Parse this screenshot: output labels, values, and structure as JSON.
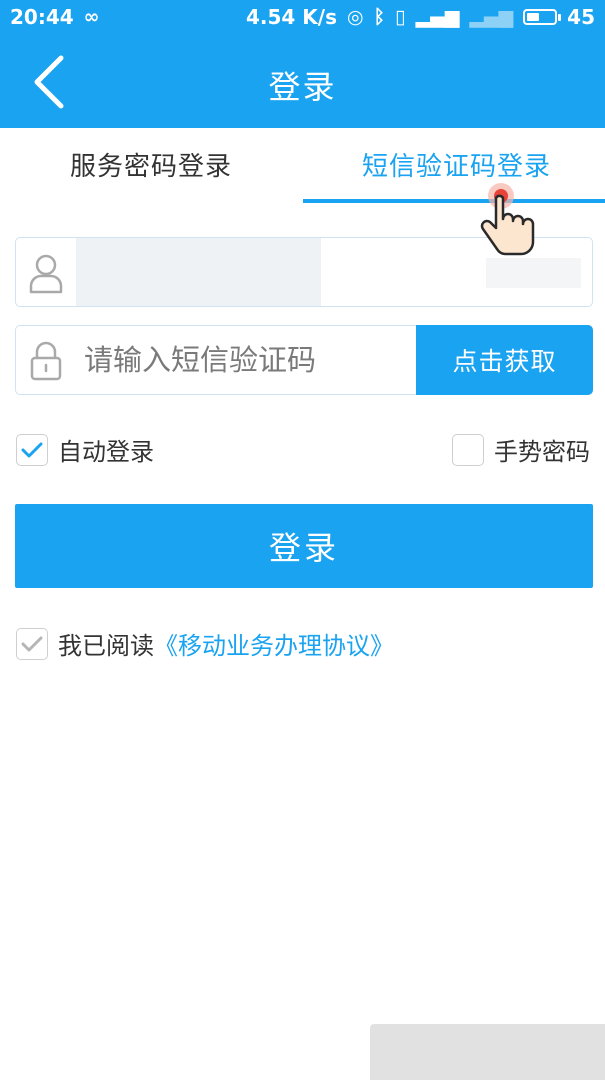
{
  "statusbar": {
    "time": "20:44",
    "speed": "4.54 K/s",
    "battery": "45"
  },
  "header": {
    "title": "登录"
  },
  "tabs": [
    {
      "label": "服务密码登录",
      "active": false
    },
    {
      "label": "短信验证码登录",
      "active": true
    }
  ],
  "form": {
    "code_placeholder": "请输入短信验证码",
    "get_code_label": "点击获取"
  },
  "options": {
    "auto_login_label": "自动登录",
    "auto_login_checked": true,
    "gesture_label": "手势密码",
    "gesture_checked": false
  },
  "login_button": "登录",
  "agreement": {
    "prefix": "我已阅读",
    "link": "《移动业务办理协议》",
    "checked": true
  },
  "colors": {
    "accent": "#1aa3f0"
  }
}
